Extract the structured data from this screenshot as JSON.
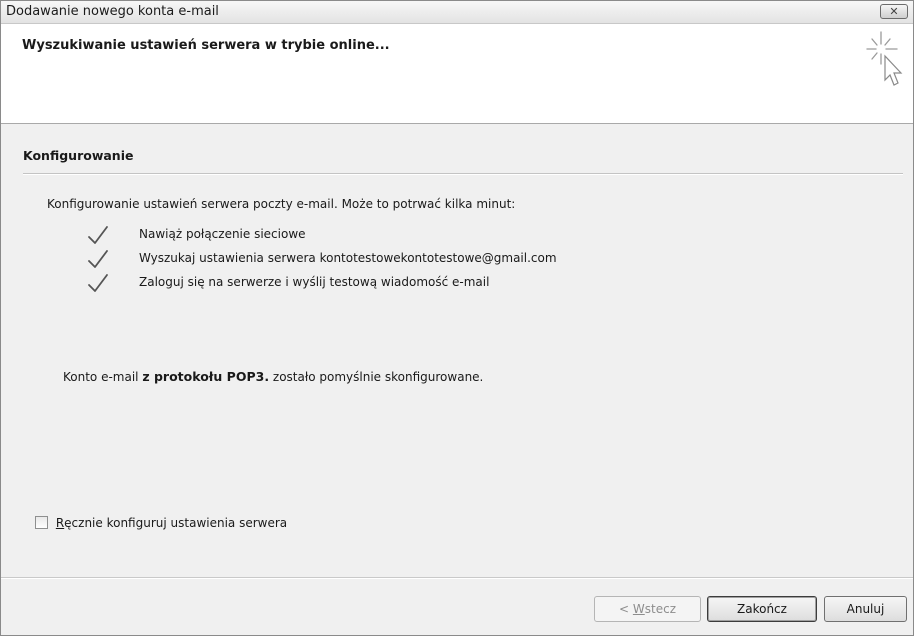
{
  "window": {
    "title": "Dodawanie nowego konta e-mail",
    "close_glyph": "✕"
  },
  "header": {
    "title": "Wyszukiwanie ustawień serwera w trybie online..."
  },
  "section": {
    "title": "Konfigurowanie",
    "description": "Konfigurowanie ustawień serwera poczty e-mail. Może to potrwać kilka minut:",
    "steps": [
      {
        "label": "Nawiąż połączenie sieciowe",
        "status": "done"
      },
      {
        "label": "Wyszukaj ustawienia serwera kontotestowekontotestowe@gmail.com",
        "status": "done"
      },
      {
        "label": "Zaloguj się na serwerze i wyślij testową wiadomość e-mail",
        "status": "done"
      }
    ]
  },
  "result": {
    "prefix": "Konto e-mail ",
    "bold": "z protokołu POP3.",
    "suffix": " zostało pomyślnie skonfigurowane."
  },
  "manual_config": {
    "mnemonic": "R",
    "label_rest": "ęcznie konfiguruj ustawienia serwera",
    "checked": false
  },
  "buttons": {
    "back_prefix": "< ",
    "back_mnemonic": "W",
    "back_rest": "stecz",
    "back_enabled": false,
    "finish": "Zakończ",
    "cancel": "Anuluj"
  },
  "icons": {
    "header": "cursor-sparkle-icon",
    "step": "checkmark-icon",
    "close": "close-icon"
  }
}
